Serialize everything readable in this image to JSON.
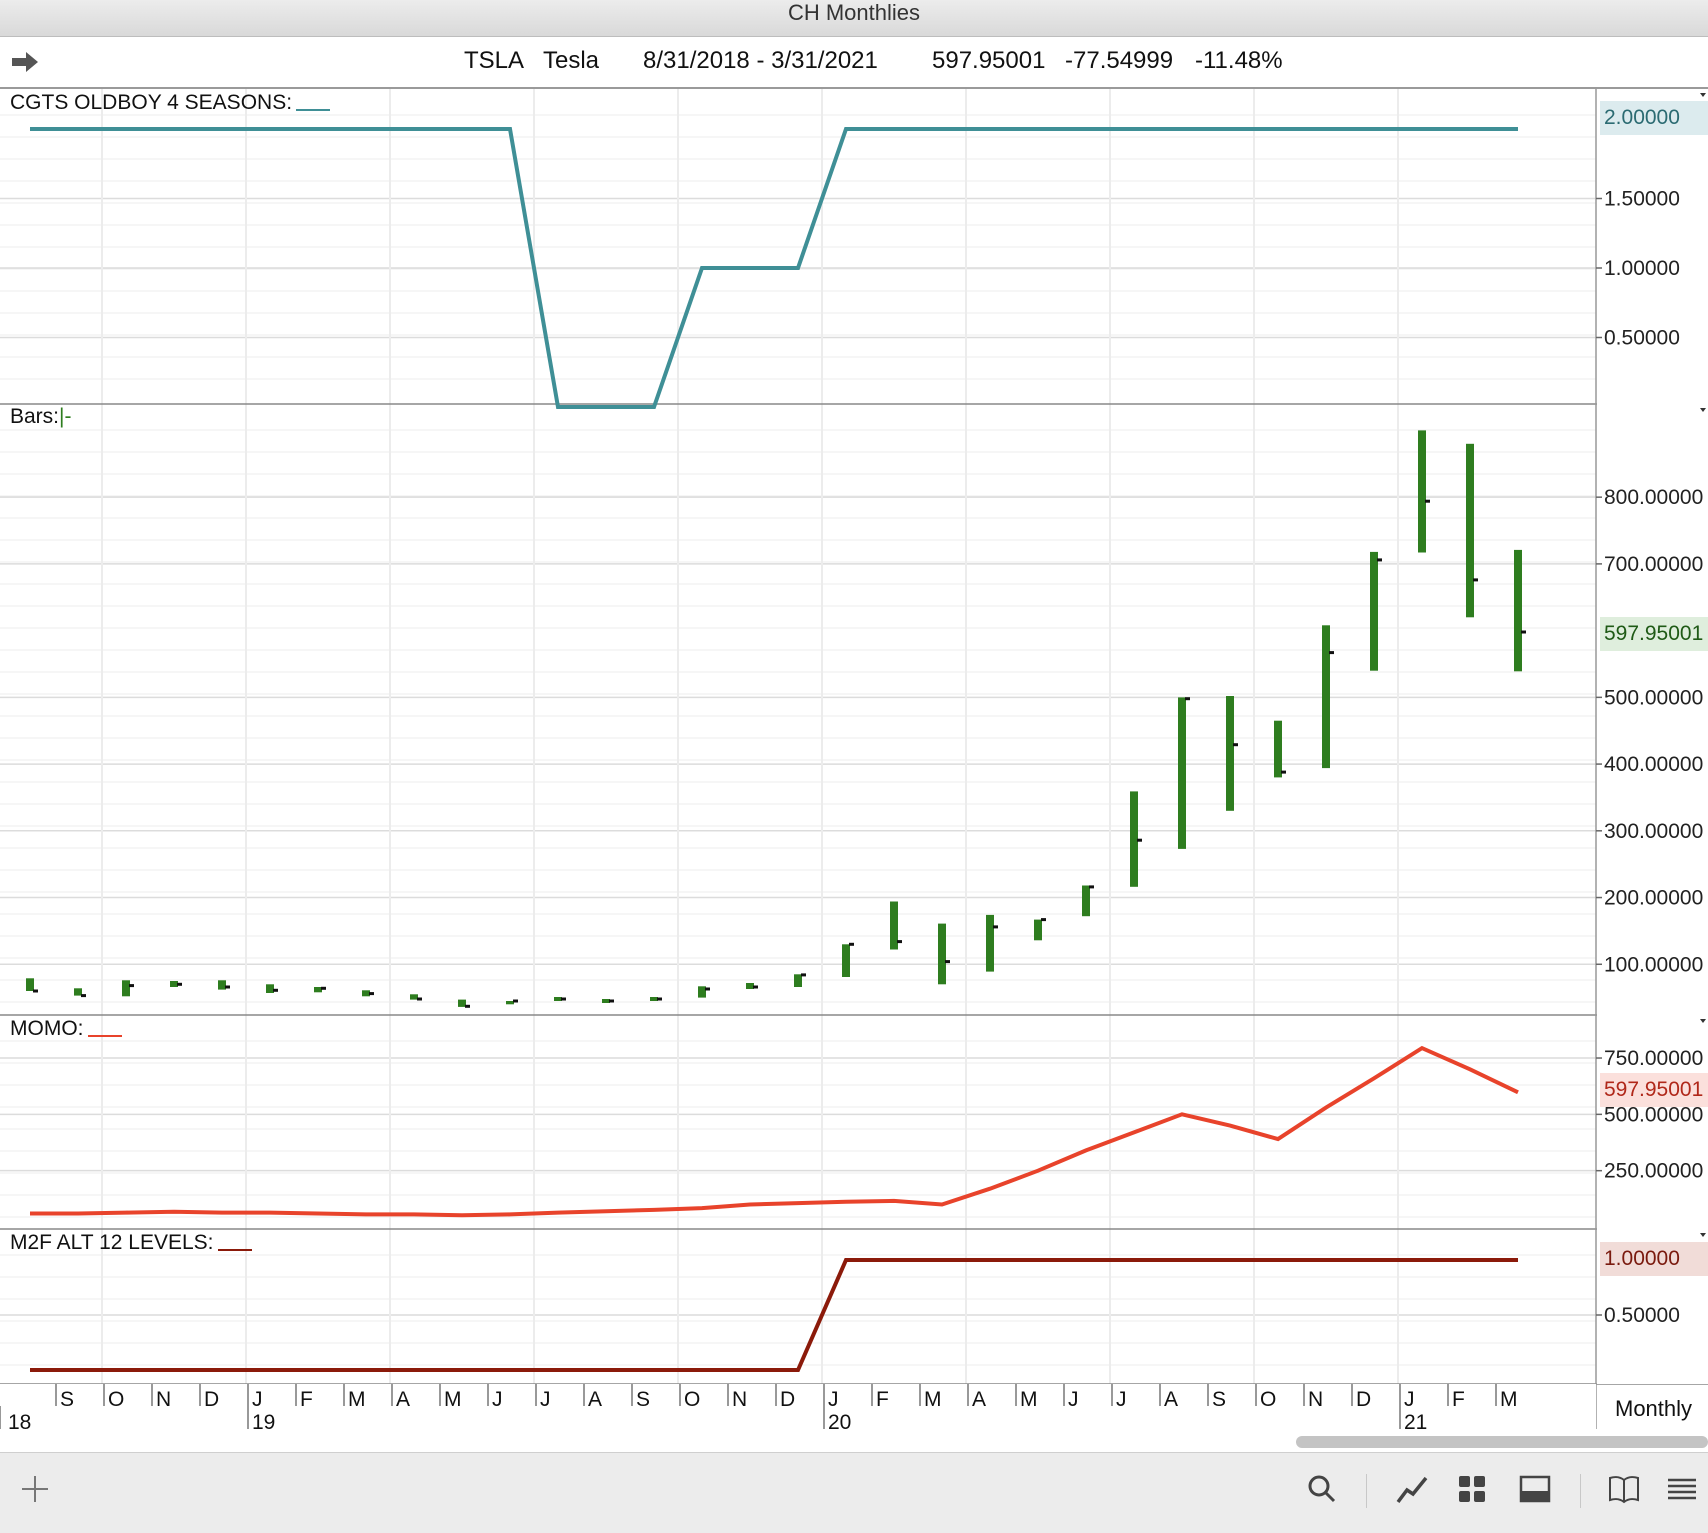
{
  "window": {
    "title": "CH Monthlies"
  },
  "header": {
    "symbol": "TSLA",
    "name": "Tesla",
    "range": "8/31/2018 - 3/31/2021",
    "last": "597.95001",
    "change": "-77.54999",
    "change_pct": "-11.48%"
  },
  "panels": {
    "seasons": {
      "label": "CGTS OLDBOY 4 SEASONS:",
      "color": "#3f8f96",
      "badge": "2.00000",
      "ticks": [
        "1.50000",
        "1.00000",
        "0.50000"
      ]
    },
    "bars": {
      "label": "Bars:",
      "label_suffix": "|-",
      "color": "#2e7d1f",
      "badge": "597.95001",
      "ticks": [
        "800.00000",
        "700.00000",
        "500.00000",
        "400.00000",
        "300.00000",
        "200.00000",
        "100.00000"
      ]
    },
    "momo": {
      "label": "MOMO:",
      "color": "#e8432b",
      "badge": "597.95001",
      "ticks": [
        "750.00000",
        "500.00000",
        "250.00000"
      ]
    },
    "m2f": {
      "label": "M2F ALT 12 LEVELS:",
      "color": "#8b1a0a",
      "badge": "1.00000",
      "ticks": [
        "0.50000"
      ]
    }
  },
  "x_axis": {
    "months": [
      "S",
      "O",
      "N",
      "D",
      "J",
      "F",
      "M",
      "A",
      "M",
      "J",
      "J",
      "A",
      "S",
      "O",
      "N",
      "D",
      "J",
      "F",
      "M",
      "A",
      "M",
      "J",
      "J",
      "A",
      "S",
      "O",
      "N",
      "D",
      "J",
      "F",
      "M"
    ],
    "years": [
      "18",
      "19",
      "20",
      "21"
    ],
    "period": "Monthly"
  },
  "chart_data": [
    {
      "type": "line",
      "title": "CGTS OLDBOY 4 SEASONS",
      "x": [
        "2018-08",
        "2018-09",
        "2018-10",
        "2018-11",
        "2018-12",
        "2019-01",
        "2019-02",
        "2019-03",
        "2019-04",
        "2019-05",
        "2019-06",
        "2019-07",
        "2019-08",
        "2019-09",
        "2019-10",
        "2019-11",
        "2019-12",
        "2020-01",
        "2020-02",
        "2020-03",
        "2020-04",
        "2020-05",
        "2020-06",
        "2020-07",
        "2020-08",
        "2020-09",
        "2020-10",
        "2020-11",
        "2020-12",
        "2021-01",
        "2021-02",
        "2021-03"
      ],
      "values": [
        2,
        2,
        2,
        2,
        2,
        2,
        2,
        2,
        2,
        2,
        2,
        0,
        0,
        0,
        1,
        1,
        1,
        2,
        2,
        2,
        2,
        2,
        2,
        2,
        2,
        2,
        2,
        2,
        2,
        2,
        2,
        2
      ],
      "ylim": [
        0,
        2.2
      ]
    },
    {
      "type": "bar",
      "subtype": "ohlc",
      "title": "Bars",
      "x": [
        "2018-08",
        "2018-09",
        "2018-10",
        "2018-11",
        "2018-12",
        "2019-01",
        "2019-02",
        "2019-03",
        "2019-04",
        "2019-05",
        "2019-06",
        "2019-07",
        "2019-08",
        "2019-09",
        "2019-10",
        "2019-11",
        "2019-12",
        "2020-01",
        "2020-02",
        "2020-03",
        "2020-04",
        "2020-05",
        "2020-06",
        "2020-07",
        "2020-08",
        "2020-09",
        "2020-10",
        "2020-11",
        "2020-12",
        "2021-01",
        "2021-02",
        "2021-03"
      ],
      "high": [
        79,
        64,
        76,
        75,
        76,
        70,
        66,
        61,
        55,
        47,
        45,
        51,
        48,
        51,
        67,
        72,
        85,
        130,
        194,
        161,
        174,
        167,
        218,
        359,
        500,
        502,
        465,
        608,
        718,
        900,
        880,
        721
      ],
      "low": [
        60,
        53,
        52,
        66,
        62,
        57,
        58,
        52,
        47,
        36,
        40,
        45,
        42,
        45,
        50,
        63,
        66,
        81,
        122,
        70,
        89,
        136,
        172,
        216,
        273,
        330,
        380,
        394,
        540,
        717,
        620,
        539
      ],
      "close": [
        60,
        53,
        68,
        70,
        66,
        61,
        64,
        56,
        48,
        37,
        45,
        48,
        45,
        48,
        63,
        66,
        84,
        130,
        134,
        104,
        156,
        167,
        216,
        286,
        498,
        429,
        388,
        567,
        706,
        794,
        676,
        598
      ],
      "ylim": [
        0,
        900
      ]
    },
    {
      "type": "line",
      "title": "MOMO",
      "x": [
        "2018-08",
        "2018-09",
        "2018-10",
        "2018-11",
        "2018-12",
        "2019-01",
        "2019-02",
        "2019-03",
        "2019-04",
        "2019-05",
        "2019-06",
        "2019-07",
        "2019-08",
        "2019-09",
        "2019-10",
        "2019-11",
        "2019-12",
        "2020-01",
        "2020-02",
        "2020-03",
        "2020-04",
        "2020-05",
        "2020-06",
        "2020-07",
        "2020-08",
        "2020-09",
        "2020-10",
        "2020-11",
        "2020-12",
        "2021-01",
        "2021-02",
        "2021-03"
      ],
      "values": [
        60,
        60,
        64,
        68,
        64,
        64,
        60,
        56,
        56,
        52,
        56,
        64,
        70,
        76,
        84,
        100,
        106,
        112,
        116,
        100,
        170,
        250,
        340,
        420,
        500,
        450,
        390,
        530,
        660,
        794,
        700,
        598
      ],
      "ylim": [
        0,
        850
      ]
    },
    {
      "type": "line",
      "title": "M2F ALT 12 LEVELS",
      "x": [
        "2018-08",
        "2018-09",
        "2018-10",
        "2018-11",
        "2018-12",
        "2019-01",
        "2019-02",
        "2019-03",
        "2019-04",
        "2019-05",
        "2019-06",
        "2019-07",
        "2019-08",
        "2019-09",
        "2019-10",
        "2019-11",
        "2019-12",
        "2020-01",
        "2020-02",
        "2020-03",
        "2020-04",
        "2020-05",
        "2020-06",
        "2020-07",
        "2020-08",
        "2020-09",
        "2020-10",
        "2020-11",
        "2020-12",
        "2021-01",
        "2021-02",
        "2021-03"
      ],
      "values": [
        0,
        0,
        0,
        0,
        0,
        0,
        0,
        0,
        0,
        0,
        0,
        0,
        0,
        0,
        0,
        0,
        0,
        1,
        1,
        1,
        1,
        1,
        1,
        1,
        1,
        1,
        1,
        1,
        1,
        1,
        1,
        1
      ],
      "ylim": [
        0,
        1.1
      ]
    }
  ]
}
